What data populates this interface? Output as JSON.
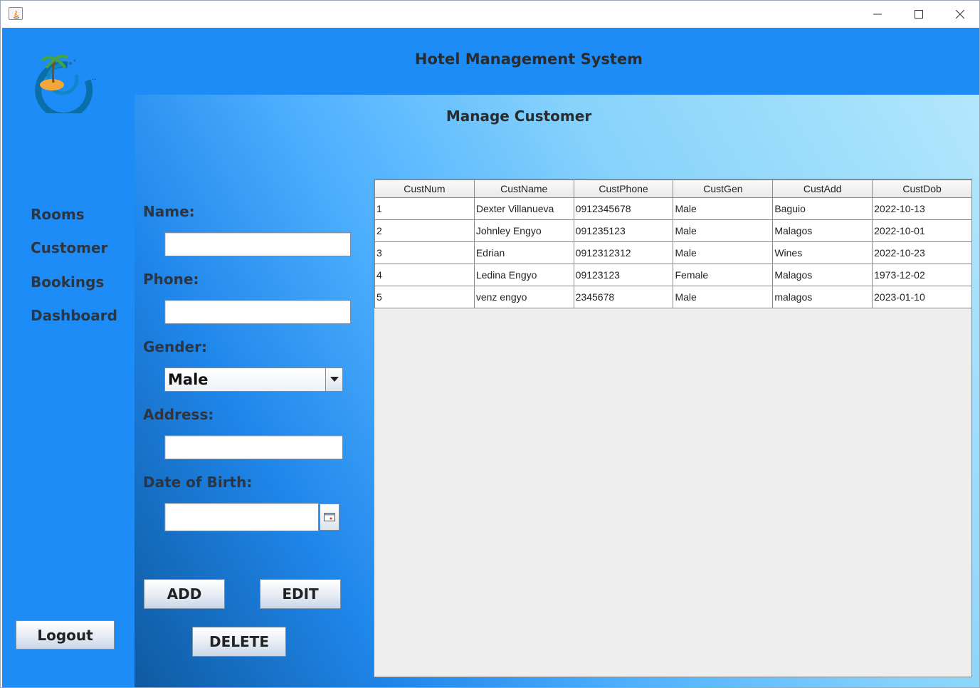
{
  "window": {
    "icon": "java-icon"
  },
  "app": {
    "title": "Hotel Management System"
  },
  "logo": {
    "icon": "island-logo-icon",
    "suffix": ".."
  },
  "nav": {
    "rooms": "Rooms",
    "customer": "Customer",
    "bookings": "Bookings",
    "dashboard": "Dashboard",
    "logout": "Logout"
  },
  "panel": {
    "title": "Manage Customer"
  },
  "form": {
    "name_label": "Name:",
    "name_value": "",
    "phone_label": "Phone:",
    "phone_value": "",
    "gender_label": "Gender:",
    "gender_value": "Male",
    "address_label": "Address:",
    "address_value": "",
    "dob_label": "Date of Birth:",
    "dob_value": ""
  },
  "buttons": {
    "add": "ADD",
    "edit": "EDIT",
    "delete": "DELETE"
  },
  "table": {
    "columns": [
      "CustNum",
      "CustName",
      "CustPhone",
      "CustGen",
      "CustAdd",
      "CustDob"
    ],
    "rows": [
      [
        "1",
        "Dexter Villanueva",
        "0912345678",
        "Male",
        "Baguio",
        "2022-10-13"
      ],
      [
        "2",
        "Johnley Engyo",
        "091235123",
        "Male",
        "Malagos",
        "2022-10-01"
      ],
      [
        "3",
        "Edrian",
        "0912312312",
        "Male",
        "Wines",
        "2022-10-23"
      ],
      [
        "4",
        "Ledina Engyo",
        "09123123",
        "Female",
        "Malagos",
        "1973-12-02"
      ],
      [
        "5",
        "venz engyo",
        "2345678",
        "Male",
        "malagos",
        "2023-01-10"
      ]
    ]
  }
}
